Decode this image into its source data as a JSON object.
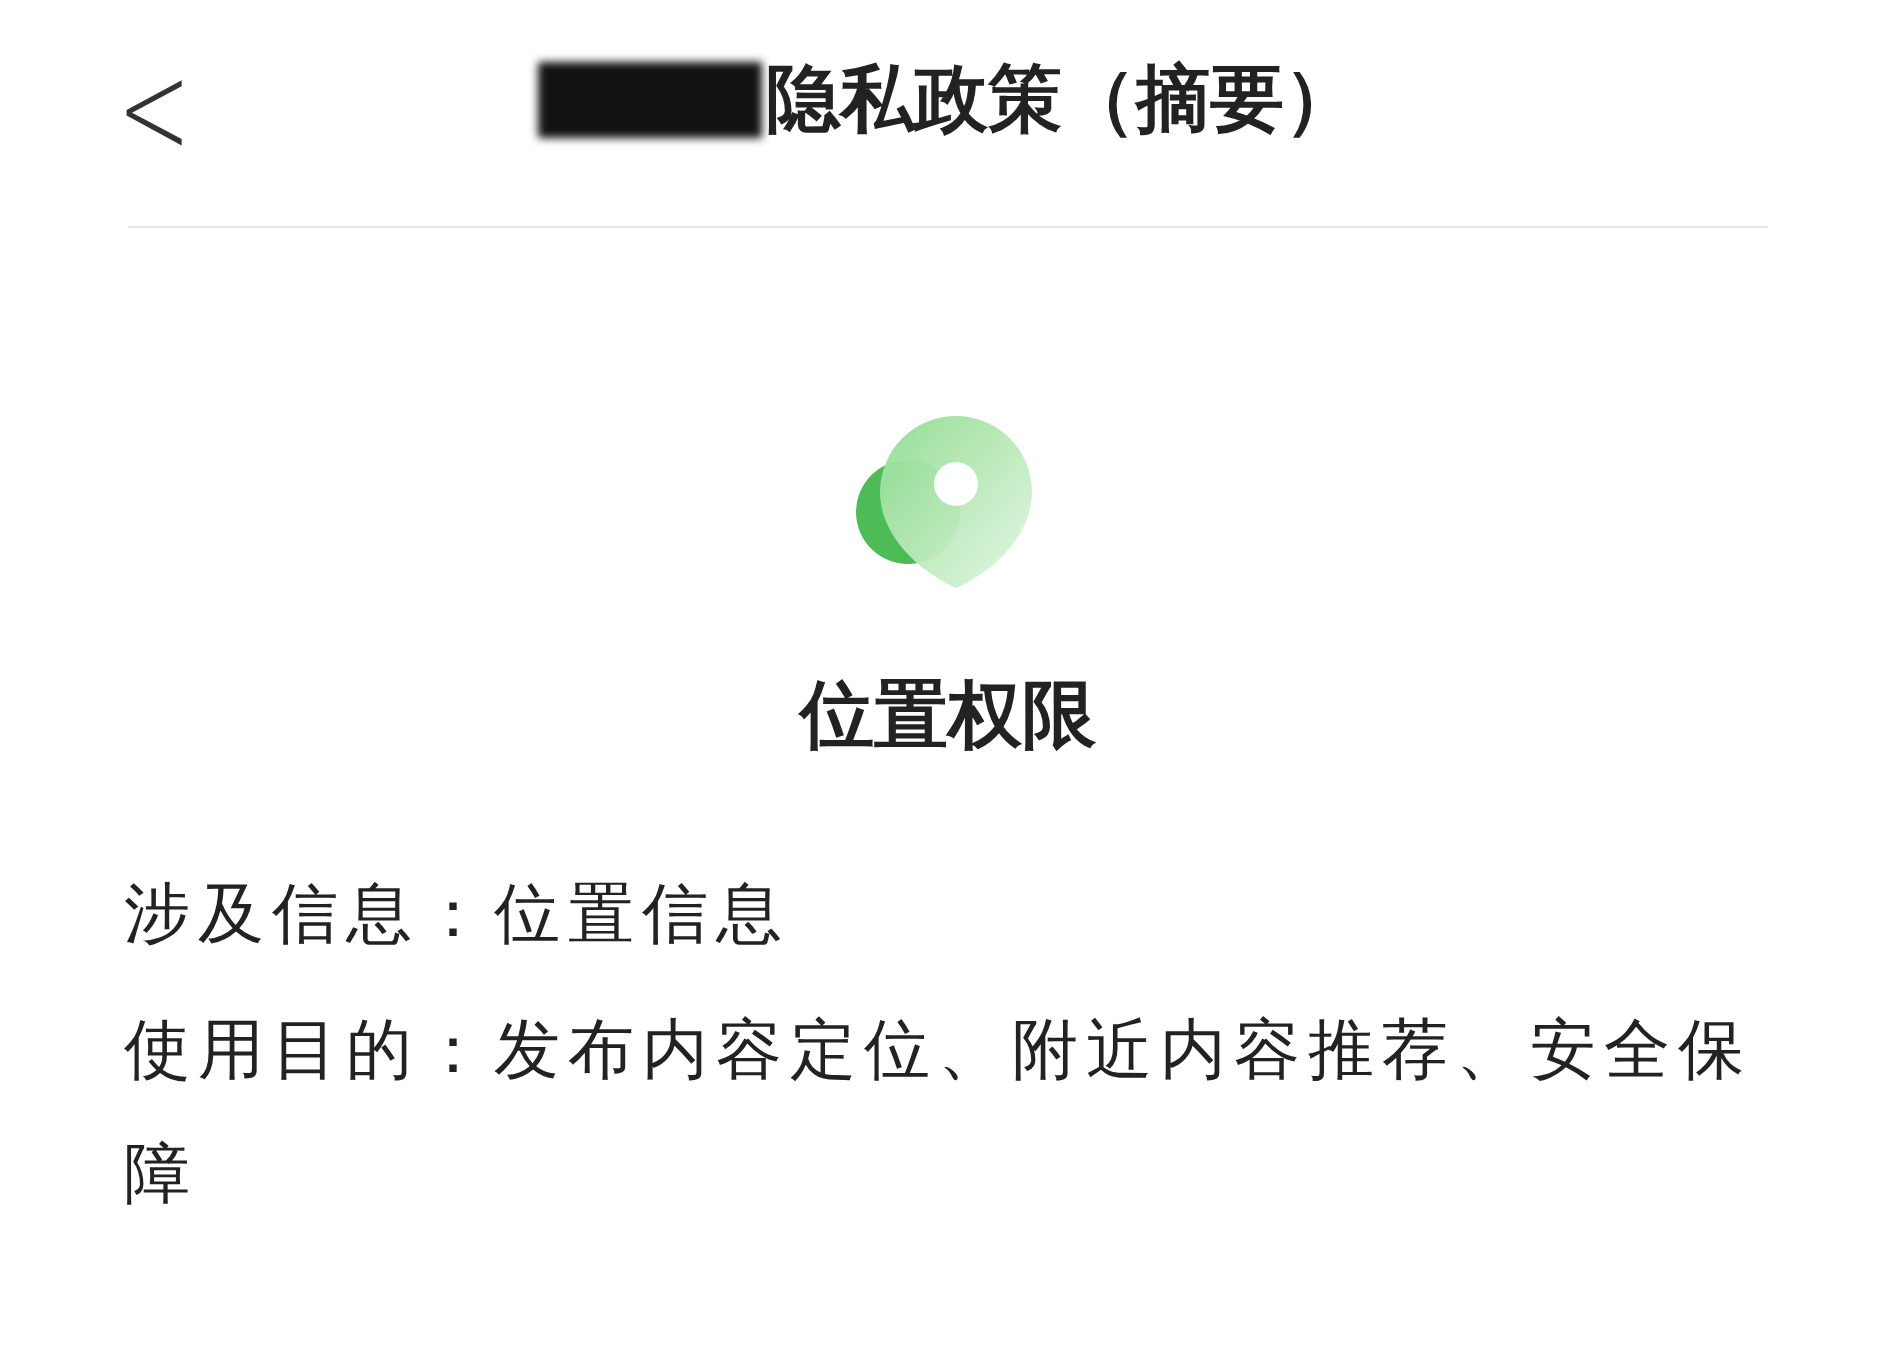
{
  "header": {
    "back": "<",
    "title": "隐私政策（摘要）"
  },
  "permission": {
    "title": "位置权限"
  },
  "details": [
    "涉及信息：位置信息",
    "使用目的：发布内容定位、附近内容推荐、安全保障"
  ]
}
